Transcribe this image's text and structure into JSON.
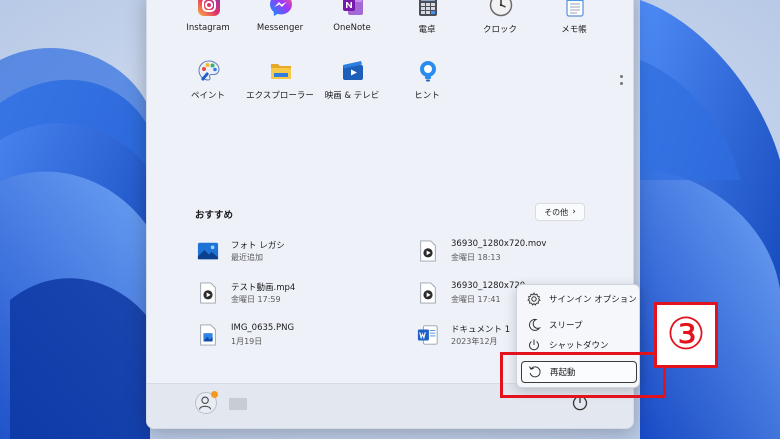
{
  "pinned_apps": [
    {
      "name": "Instagram",
      "icon": "instagram-icon"
    },
    {
      "name": "Messenger",
      "icon": "messenger-icon"
    },
    {
      "name": "OneNote",
      "icon": "onenote-icon"
    },
    {
      "name": "電卓",
      "icon": "calculator-icon"
    },
    {
      "name": "クロック",
      "icon": "clock-icon"
    },
    {
      "name": "メモ帳",
      "icon": "notepad-icon"
    },
    {
      "name": "ペイント",
      "icon": "paint-icon"
    },
    {
      "name": "エクスプローラー",
      "icon": "file-explorer-icon"
    },
    {
      "name": "映画 & テレビ",
      "icon": "movies-tv-icon"
    },
    {
      "name": "ヒント",
      "icon": "tips-icon"
    }
  ],
  "recommended": {
    "title": "おすすめ",
    "more_label": "その他",
    "items": [
      {
        "name": "フォト レガシ",
        "meta": "最近追加",
        "icon": "photos-legacy-icon"
      },
      {
        "name": "36930_1280x720.mov",
        "meta": "金曜日 18:13",
        "icon": "video-file-icon"
      },
      {
        "name": "テスト動画.mp4",
        "meta": "金曜日 17:59",
        "icon": "video-file-icon"
      },
      {
        "name": "36930_1280x720.",
        "meta": "金曜日 17:41",
        "icon": "video-file-icon"
      },
      {
        "name": "IMG_0635.PNG",
        "meta": "1月19日",
        "icon": "image-file-icon"
      },
      {
        "name": "ドキュメント 1",
        "meta": "2023年12月",
        "icon": "word-document-icon"
      }
    ]
  },
  "power_menu": {
    "items": [
      {
        "label": "サインイン オプション",
        "icon": "gear-icon"
      },
      {
        "label": "スリープ",
        "icon": "moon-icon"
      },
      {
        "label": "シャットダウン",
        "icon": "power-icon"
      },
      {
        "label": "再起動",
        "icon": "restart-icon"
      }
    ]
  },
  "annotation": {
    "step_label": "③"
  },
  "colors": {
    "accent_red": "#e3131e",
    "wallpaper_blue": "#1e56c8"
  }
}
